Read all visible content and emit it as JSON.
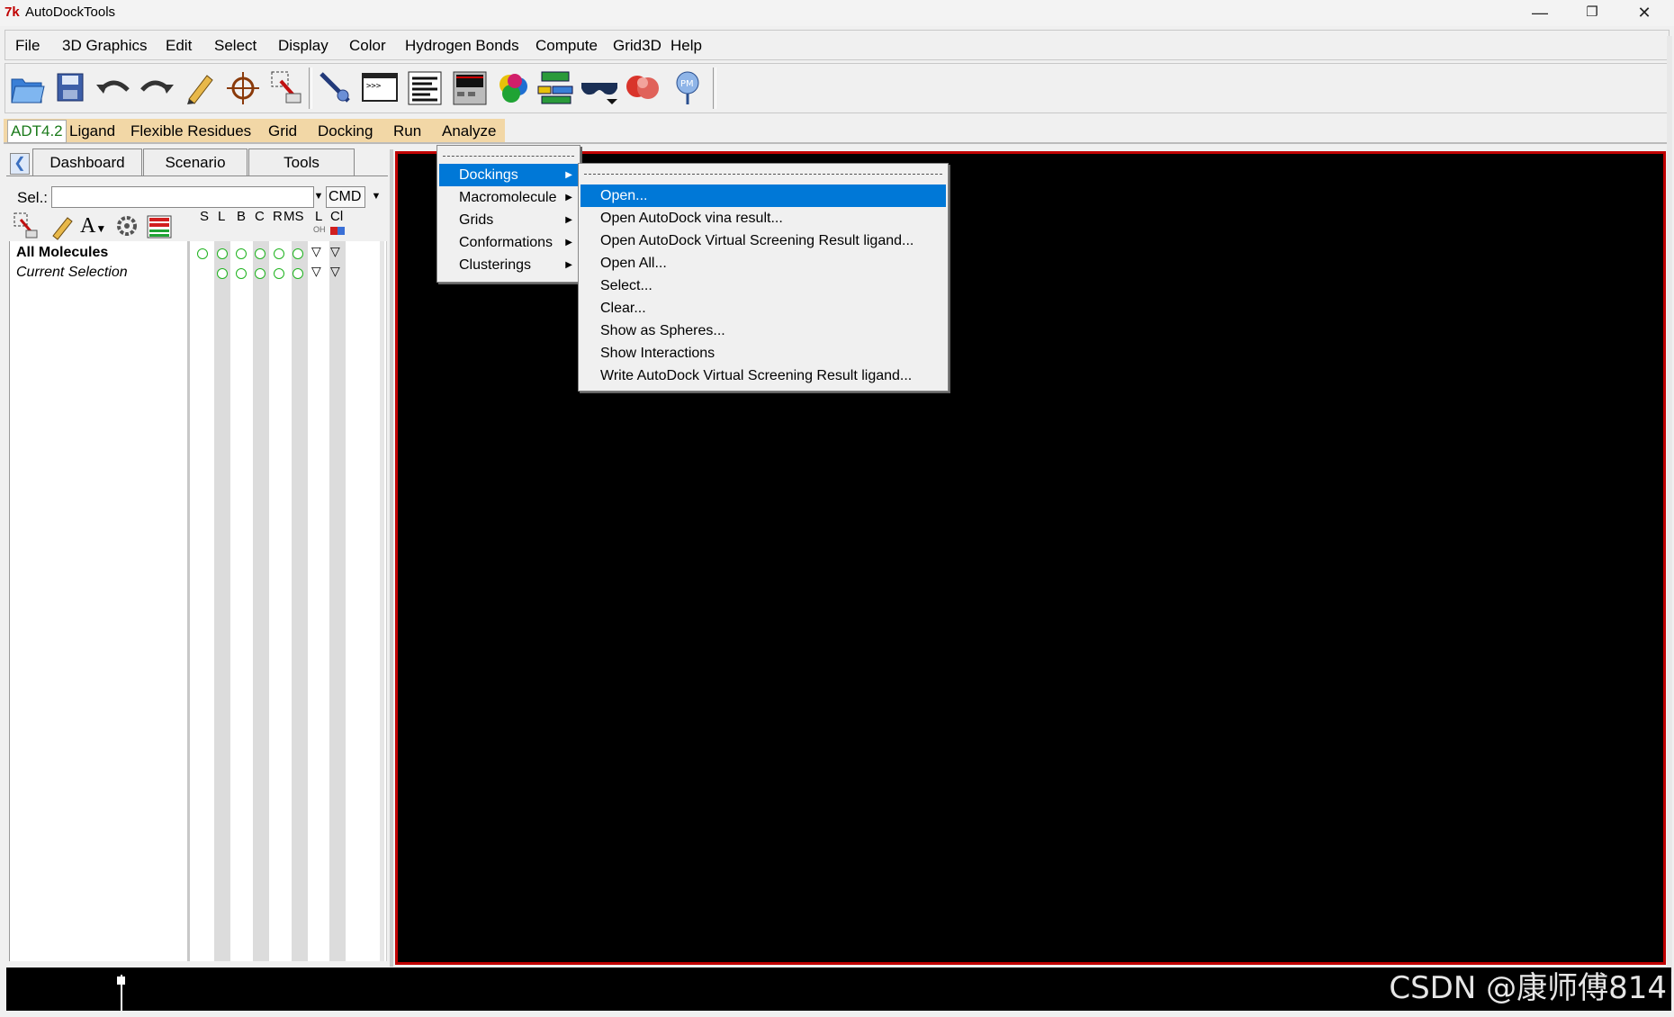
{
  "window": {
    "logo": "7k",
    "title": "AutoDockTools",
    "minimize": "—",
    "restore": "❐",
    "close": "✕"
  },
  "menubar": [
    "File",
    "3D Graphics",
    "Edit",
    "Select",
    "Display",
    "Color",
    "Hydrogen Bonds",
    "Compute",
    "Grid3D",
    "Help"
  ],
  "adt_menu": {
    "version": "ADT4.2",
    "items": [
      "Ligand",
      "Flexible Residues",
      "Grid",
      "Docking",
      "Run",
      "Analyze"
    ]
  },
  "left_panel": {
    "tabs": [
      "Dashboard",
      "Scenario",
      "Tools"
    ],
    "sel_label": "Sel.:",
    "sel_value": "",
    "cmd_label": "CMD",
    "columns": [
      {
        "label": "S",
        "sub": ""
      },
      {
        "label": "L",
        "sub": ""
      },
      {
        "label": "B",
        "sub": ""
      },
      {
        "label": "C",
        "sub": ""
      },
      {
        "label": "R",
        "sub": ""
      },
      {
        "label": "MS",
        "sub": ""
      },
      {
        "label": "L",
        "sub": "OH"
      },
      {
        "label": "Cl",
        "sub": ""
      }
    ],
    "tree": [
      {
        "label": "All Molecules",
        "bold": true
      },
      {
        "label": "Current Selection",
        "italic": true
      }
    ]
  },
  "analyze_menu": {
    "items": [
      "Dockings",
      "Macromolecule",
      "Grids",
      "Conformations",
      "Clusterings"
    ],
    "highlighted": "Dockings"
  },
  "dockings_submenu": {
    "items": [
      "Open...",
      "Open AutoDock vina result...",
      "Open AutoDock Virtual Screening Result ligand...",
      "Open All...",
      "Select...",
      "Clear...",
      "Show as Spheres...",
      "Show Interactions",
      "Write AutoDock Virtual Screening Result ligand..."
    ],
    "highlighted": "Open..."
  },
  "watermark": "CSDN @康师傅814",
  "colors": {
    "adt_bar": "#f2d7a6",
    "highlight": "#0078d7",
    "viewer_border": "#c00000",
    "selection_circle": "#1fb31f"
  }
}
